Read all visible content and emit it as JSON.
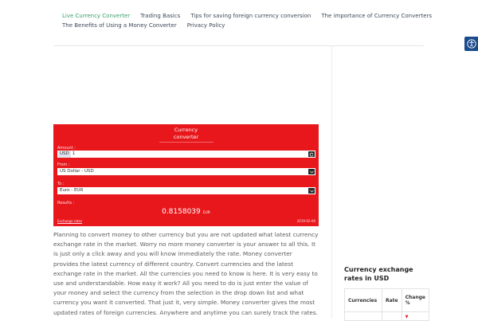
{
  "nav": {
    "row1": [
      "Live Currency Converter",
      "Trading Basics",
      "Tips for saving foreign currency conversion",
      "The importance of Currency Converters"
    ],
    "row2": [
      "The Benefits of Using a Money Converter",
      "Privacy Policy"
    ]
  },
  "converter": {
    "title_line1": "Currency",
    "title_line2": "converter",
    "amount_label": "Amount :",
    "amount_currency": "USD",
    "amount_value": "1",
    "from_label": "From :",
    "from_value": "US Dollar - USD",
    "to_label": "To :",
    "to_value": "Euro - EUR",
    "results_label": "Results :",
    "result_value": "0.8158039",
    "result_unit": "EUR",
    "exchange_link": "Exchange rates",
    "date": "2019-02-06",
    "accent_color": "#e8171c"
  },
  "article": {
    "text": "Planning to convert money to other currency but you are not updated what latest currency exchange rate in the market. Worry no more money converter is your answer to all this. It is just only a click away and you will know immediately the rate. Money converter provides the latest currency of different country. Convert currencies and the latest exchange rate in the market. All the currencies you need to know is here. It is very easy to use and understandable. How easy it work? All you need to do is just enter the value of your money and select the currency from the selection in the drop down list and what currency you want it converted. That just it, very simple. Money converter gives the most updated rates of foreign currencies. Anywhere and anytime you can surely track the rates."
  },
  "sidebar": {
    "widget_title": "Currency exchange rates in USD",
    "columns": [
      "Currencies",
      "Rate",
      "Change %"
    ],
    "change_arrow": "▼"
  },
  "icons": {
    "accessibility": "accessibility-icon",
    "refresh": "refresh-icon",
    "dropdown": "chevron-down-icon"
  }
}
